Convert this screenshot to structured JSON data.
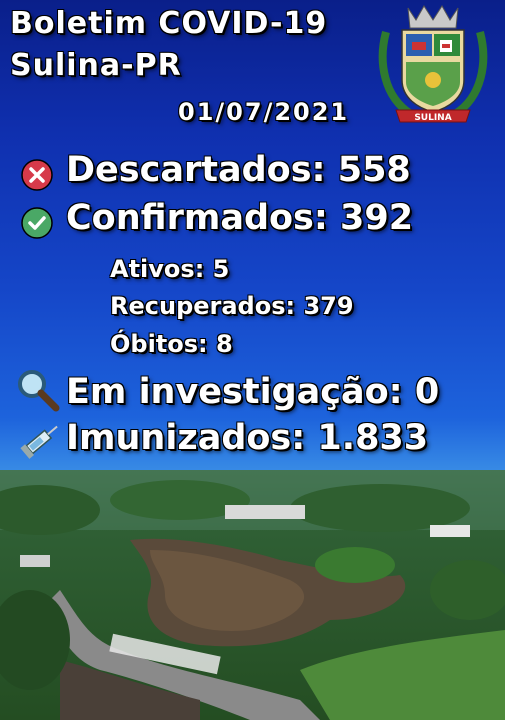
{
  "header": {
    "title_line1": "Boletim COVID-19",
    "title_line2": "Sulina-PR",
    "date": "01/07/2021"
  },
  "stats": {
    "descartados": "Descartados: 558",
    "confirmados": "Confirmados: 392",
    "ativos": "Ativos: 5",
    "recuperados": "Recuperados: 379",
    "obitos": "Óbitos: 8",
    "investigacao": "Em investigação: 0",
    "imunizados": "Imunizados: 1.833"
  },
  "crest": {
    "banner": "SULINA"
  },
  "icons": {
    "descartados": "x-circle-icon",
    "confirmados": "check-circle-icon",
    "investigacao": "magnifier-icon",
    "imunizados": "syringe-icon"
  },
  "colors": {
    "background_top": "#0a1f8a",
    "background_mid": "#1d63dc",
    "text": "#ffffff",
    "x_red": "#d63a4a",
    "check_green": "#4aa866"
  }
}
